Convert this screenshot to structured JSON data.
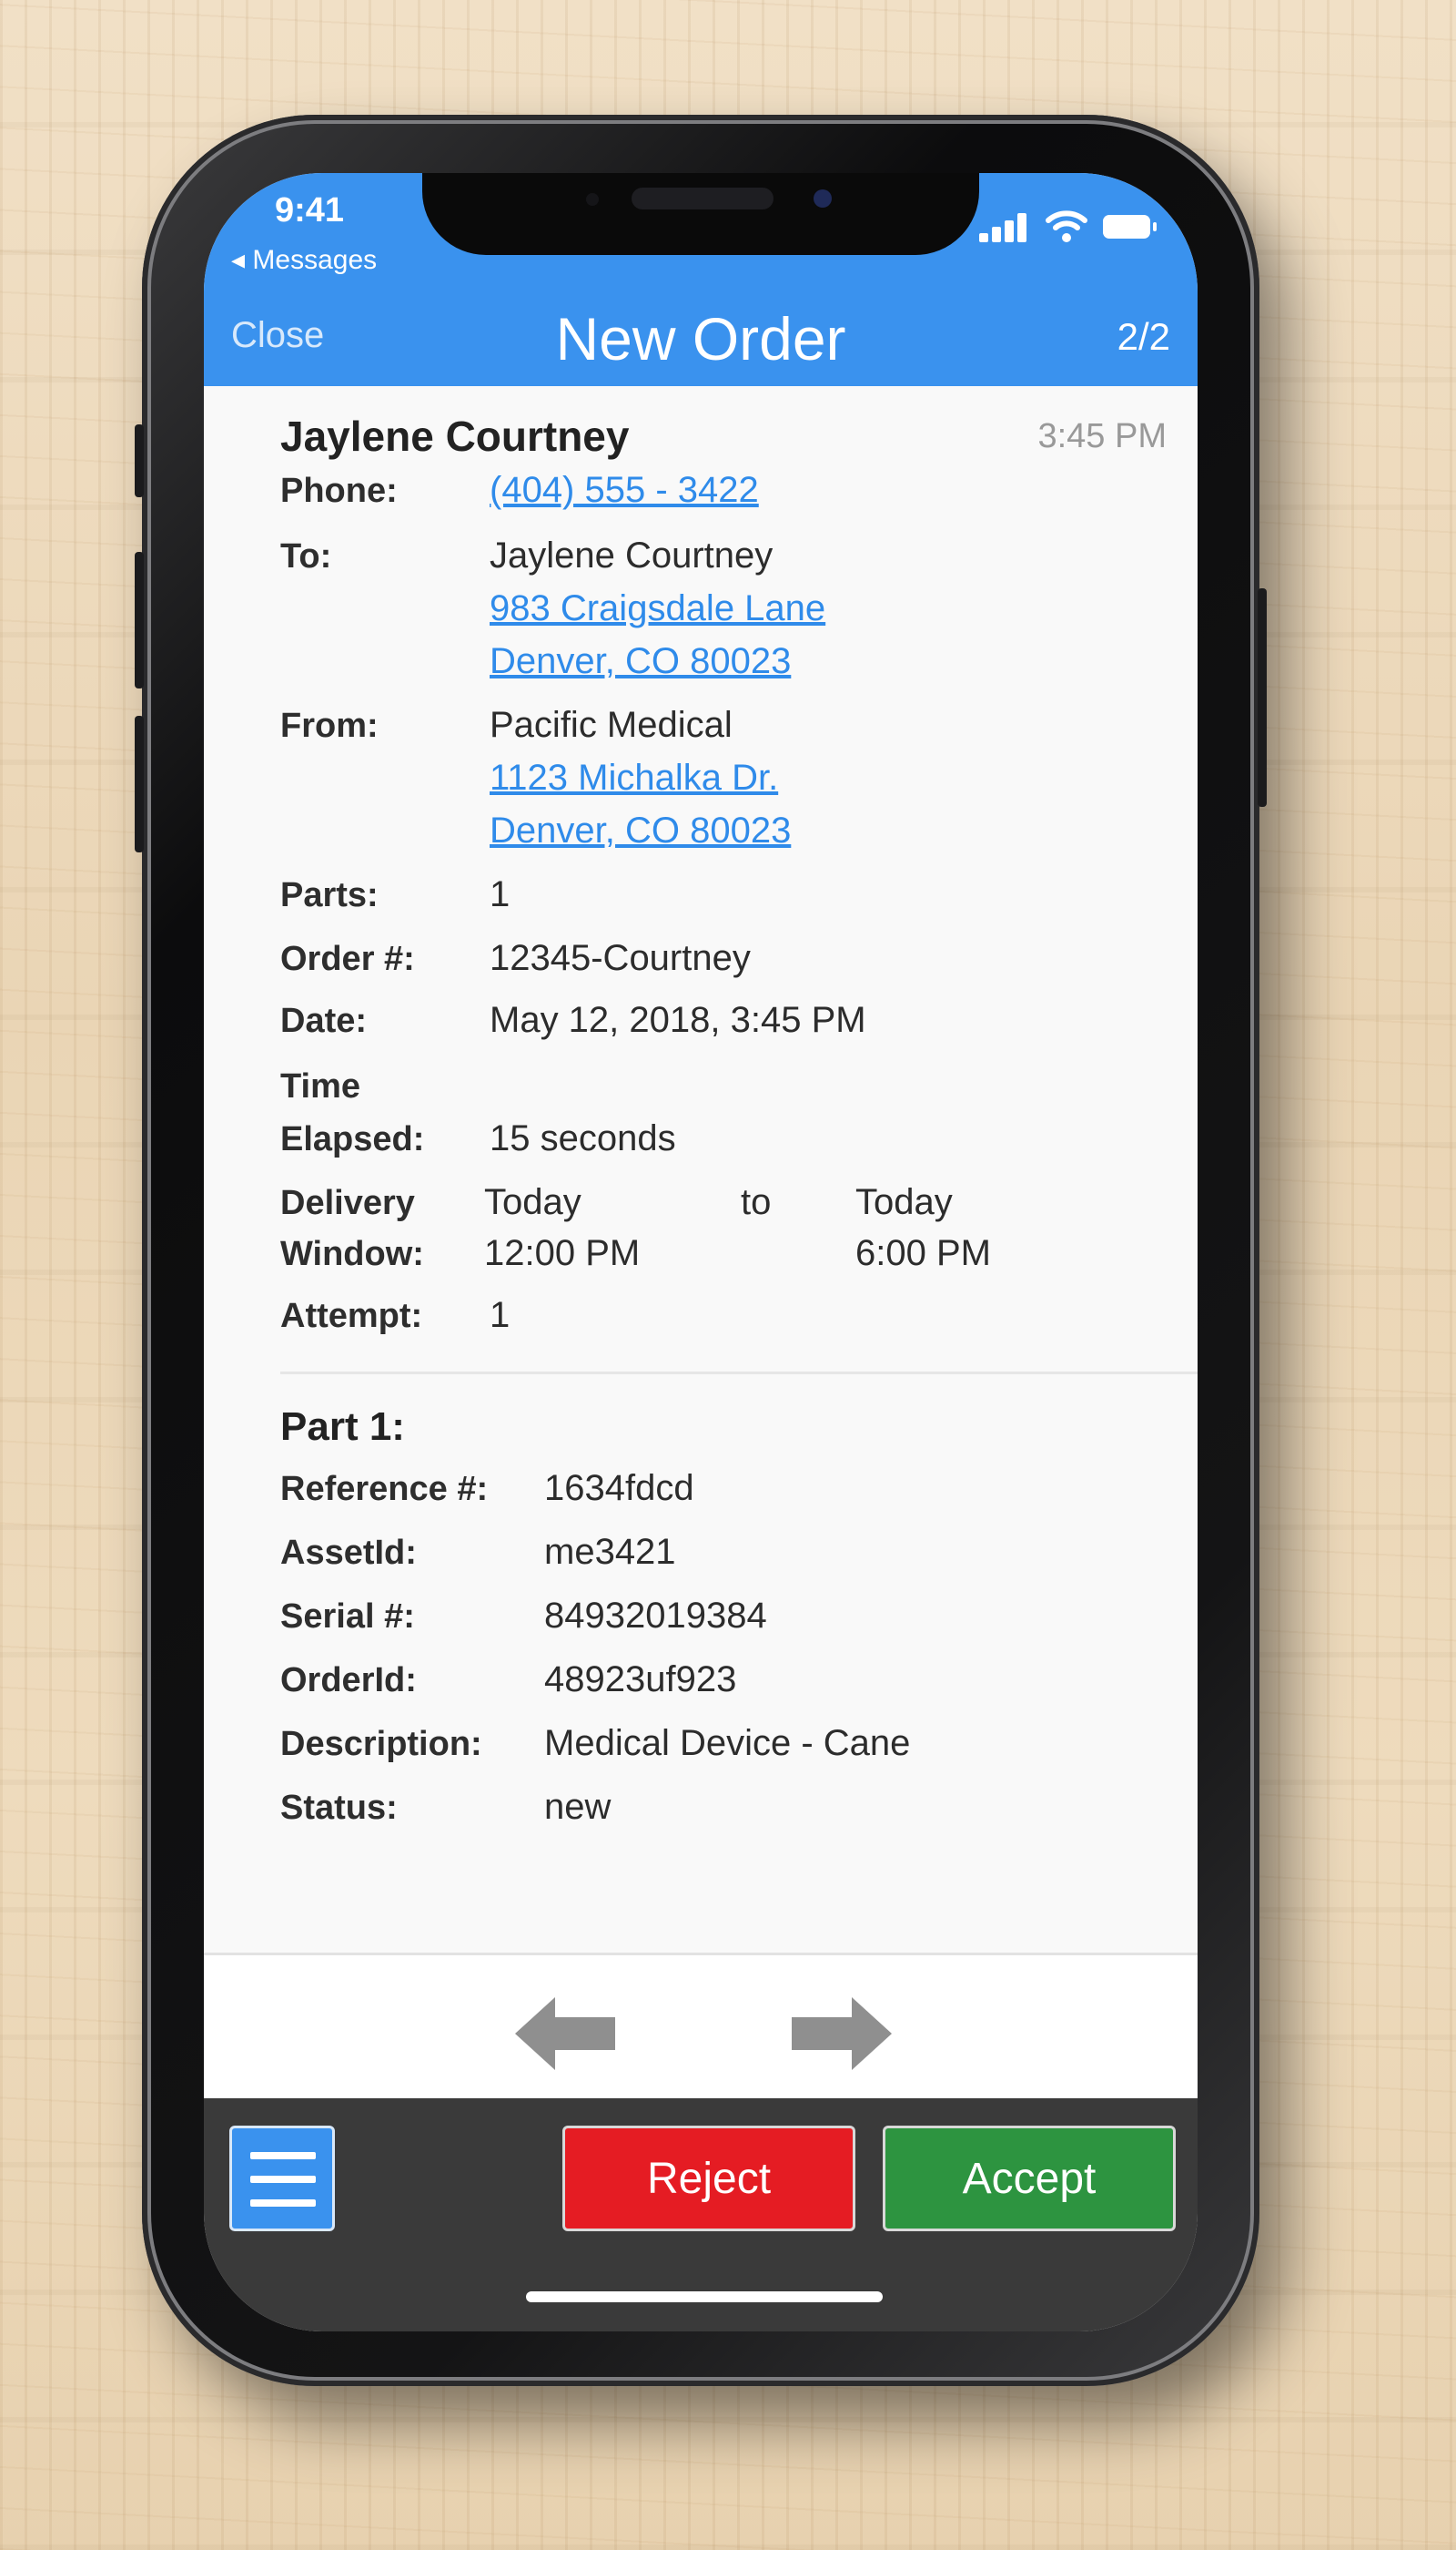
{
  "status_bar": {
    "time": "9:41",
    "back_app": "◂ Messages"
  },
  "header": {
    "close_label": "Close",
    "title": "New Order",
    "page_count": "2/2"
  },
  "order": {
    "customer_name": "Jaylene Courtney",
    "received_time": "3:45 PM",
    "phone_label": "Phone:",
    "phone": "(404) 555 - 3422",
    "to_label": "To:",
    "to_name": "Jaylene Courtney",
    "to_address_line1": "983 Craigsdale Lane",
    "to_address_line2": "Denver, CO 80023",
    "from_label": "From:",
    "from_name": "Pacific Medical",
    "from_address_line1": "1123 Michalka Dr.",
    "from_address_line2": "Denver, CO 80023",
    "parts_label": "Parts:",
    "parts": "1",
    "order_no_label": "Order #:",
    "order_no": "12345-Courtney",
    "date_label": "Date:",
    "date": "May 12, 2018, 3:45 PM",
    "elapsed_label_line1": "Time",
    "elapsed_label_line2": "Elapsed:",
    "elapsed": "15 seconds",
    "window_label_line1": "Delivery",
    "window_label_line2": "Window:",
    "window_start_day": "Today",
    "window_start_time": "12:00 PM",
    "window_to": "to",
    "window_end_day": "Today",
    "window_end_time": "6:00 PM",
    "attempt_label": "Attempt:",
    "attempt": "1"
  },
  "part": {
    "title": "Part 1:",
    "reference_label": "Reference #:",
    "reference": "1634fdcd",
    "asset_label": "AssetId:",
    "asset": "me3421",
    "serial_label": "Serial #:",
    "serial": "84932019384",
    "orderid_label": "OrderId:",
    "orderid": "48923uf923",
    "description_label": "Description:",
    "description": "Medical Device - Cane",
    "status_label": "Status:",
    "status": "new"
  },
  "footer": {
    "reject_label": "Reject",
    "accept_label": "Accept"
  },
  "icons": {
    "prev": "arrow-left-icon",
    "next": "arrow-right-icon",
    "menu": "hamburger-menu-icon",
    "signal": "cellular-signal-icon",
    "wifi": "wifi-icon",
    "battery": "battery-icon"
  },
  "colors": {
    "header_blue": "#3a92ee",
    "link_blue": "#2f8bea",
    "reject_red": "#e51c23",
    "accept_green": "#2d9440",
    "footer_dark": "#3a3a3a"
  }
}
